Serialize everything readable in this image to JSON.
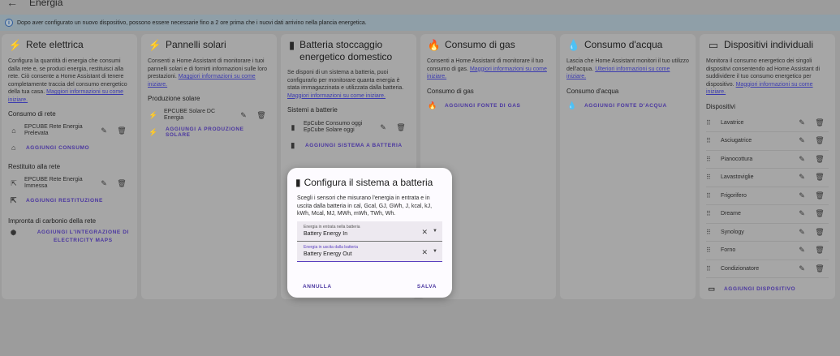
{
  "header": {
    "back_icon": "arrow-left-icon",
    "title": "Energia"
  },
  "info_banner": {
    "text": "Dopo aver configurato un nuovo dispositivo, possono essere necessarie fino a 2 ore prima che i nuovi dati arrivino nella plancia energetica."
  },
  "grid": {
    "title": "Rete elettrica",
    "description": "Configura la quantità di energia che consumi dalla rete e, se produci energia, restituisci alla rete. Ciò consente a Home Assistant di tenere completamente traccia del consumo energetico della tua casa.",
    "more_link": "Maggiori informazioni su come iniziare.",
    "consumption_title": "Consumo di rete",
    "consumption_items": [
      "EPCUBE Rete Energia Prelevata"
    ],
    "add_consumption": "AGGIUNGI CONSUMO",
    "return_title": "Restituito alla rete",
    "return_items": [
      "EPCUBE Rete Energia Immessa"
    ],
    "add_return": "AGGIUNGI RESTITUZIONE",
    "carbon_title": "Impronta di carbonio della rete",
    "add_carbon": "AGGIUNGI L'INTEGRAZIONE DI ELECTRICITY MAPS"
  },
  "solar": {
    "title": "Pannelli solari",
    "description": "Consenti a Home Assistant di monitorare i tuoi pannelli solari e di fornirti informazioni sulle loro prestazioni.",
    "more_link": "Maggiori informazioni su come iniziare.",
    "production_title": "Produzione solare",
    "items": [
      "EPCUBE Solare DC Energia"
    ],
    "add": "AGGIUNGI A PRODUZIONE SOLARE"
  },
  "battery": {
    "title": "Batteria stoccaggio energetico domestico",
    "description": "Se disponi di un sistema a batteria, puoi configurarlo per monitorare quanta energia è stata immagazzinata e utilizzata dalla batteria.",
    "more_link": "Maggiori informazioni su come iniziare.",
    "systems_title": "Sistemi a batterie",
    "items": [
      "EpCube Consumo oggi",
      "EpCube Solare oggi"
    ],
    "add": "AGGIUNGI SISTEMA A BATTERIA"
  },
  "gas": {
    "title": "Consumo di gas",
    "description": "Consenti a Home Assistant di monitorare il tuo consumo di gas.",
    "more_link": "Maggiori informazioni su come iniziare.",
    "sub_title": "Consumo di gas",
    "add": "AGGIUNGI FONTE DI GAS"
  },
  "water": {
    "title": "Consumo d'acqua",
    "description": "Lascia che Home Assistant monitori il tuo utilizzo dell'acqua.",
    "more_link": "Ulteriori informazioni su come iniziare.",
    "sub_title": "Consumo d'acqua",
    "add": "AGGIUNGI FONTE D'ACQUA"
  },
  "devices": {
    "title": "Dispositivi individuali",
    "description": "Monitora il consumo energetico dei singoli dispositivi consentendo ad Home Assistant di suddividere il tuo consumo energetico per dispositivo.",
    "more_link": "Maggiori informazioni su come iniziare.",
    "sub_title": "Dispositivi",
    "items": [
      {
        "label": "Lavatrice"
      },
      {
        "label": "Asciugatrice"
      },
      {
        "label": "Pianocottura"
      },
      {
        "label": "Lavastoviglie"
      },
      {
        "label": "Frigorifero"
      },
      {
        "label": "Dreame"
      },
      {
        "label": "Synology"
      },
      {
        "label": "Forno"
      },
      {
        "label": "Condizionatore"
      }
    ],
    "add": "AGGIUNGI DISPOSITIVO"
  },
  "dialog": {
    "title": "Configura il sistema a batteria",
    "description": "Scegli i sensori che misurano l'energia in entrata e in uscita dalla batteria in cal, Gcal, GJ, GWh, J, kcal, kJ, kWh, Mcal, MJ, MWh, mWh, TWh, Wh.",
    "field_in_label": "Energia in entrata nella batteria",
    "field_in_value": "Battery Energy In",
    "field_out_label": "Energia in uscita dalla batteria",
    "field_out_value": "Battery Energy Out",
    "cancel": "ANNULLA",
    "save": "SALVA"
  }
}
